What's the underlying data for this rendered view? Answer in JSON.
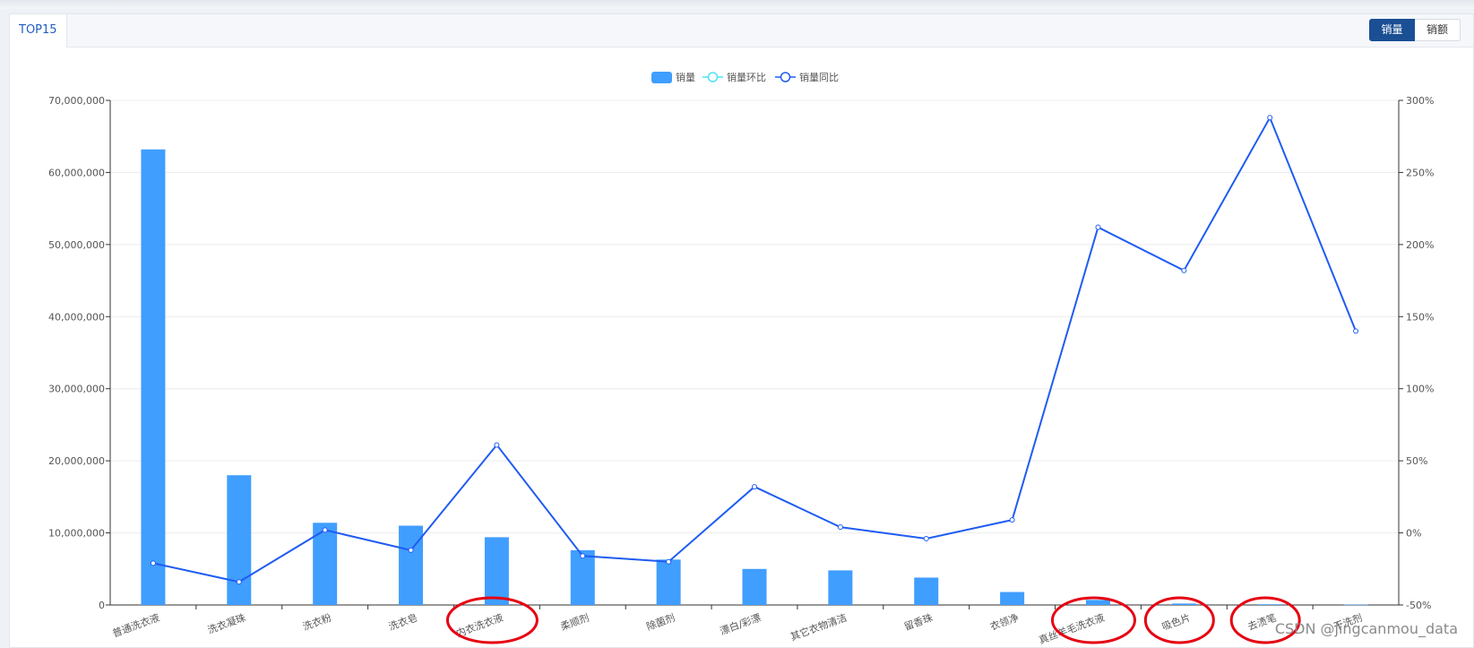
{
  "tabs": [
    {
      "label": "TOP15"
    }
  ],
  "toggle": {
    "options": [
      "销量",
      "销额"
    ],
    "active": "销量"
  },
  "watermark": "CSDN @jingcanmou_data",
  "colors": {
    "bar": "#409eff",
    "huanbi": "#4ee3f5",
    "tongbi": "#1f5cf2",
    "annotation": "#e60012",
    "grid": "#ececec"
  },
  "chart_data": {
    "type": "bar",
    "categories": [
      "普通洗衣液",
      "洗衣凝珠",
      "洗衣粉",
      "洗衣皂",
      "内衣洗衣液",
      "柔顺剂",
      "除菌剂",
      "漂白/彩漂",
      "其它衣物清洁",
      "留香珠",
      "衣领净",
      "真丝羊毛洗衣液",
      "吸色片",
      "去渍笔",
      "干洗剂"
    ],
    "legend": [
      "销量",
      "销量环比",
      "销量同比"
    ],
    "legend_position": "top-center",
    "series": [
      {
        "name": "销量",
        "type": "bar",
        "axis": "left",
        "values": [
          63200000,
          18000000,
          11400000,
          11000000,
          9400000,
          7600000,
          6300000,
          5000000,
          4800000,
          3800000,
          1800000,
          700000,
          200000,
          100000,
          50000
        ]
      },
      {
        "name": "销量环比",
        "type": "line",
        "axis": "right",
        "values": []
      },
      {
        "name": "销量同比",
        "type": "line",
        "axis": "right",
        "values": [
          -21,
          -34,
          2,
          -12,
          61,
          -16,
          -20,
          32,
          4,
          -4,
          9,
          212,
          182,
          288,
          140
        ]
      }
    ],
    "y_left": {
      "min": 0,
      "max": 70000000,
      "ticks": [
        "0",
        "10,000,000",
        "20,000,000",
        "30,000,000",
        "40,000,000",
        "50,000,000",
        "60,000,000",
        "70,000,000"
      ]
    },
    "y_right": {
      "min": -50,
      "max": 300,
      "ticks": [
        "-50%",
        "0%",
        "50%",
        "100%",
        "150%",
        "200%",
        "250%",
        "300%"
      ]
    },
    "grid": true,
    "highlighted_categories": [
      "内衣洗衣液",
      "真丝羊毛洗衣液",
      "吸色片",
      "去渍笔"
    ]
  }
}
